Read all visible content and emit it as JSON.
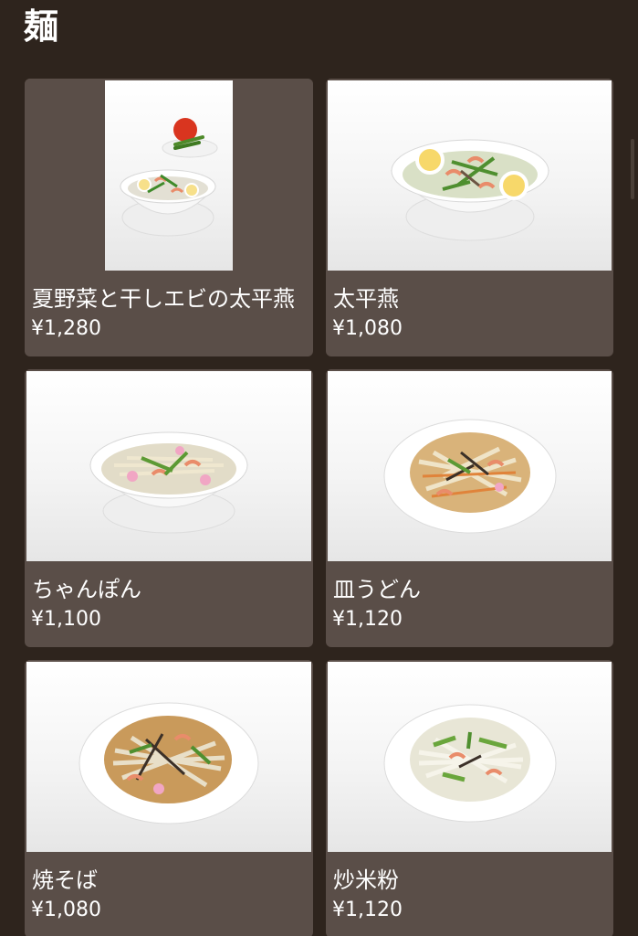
{
  "section": {
    "title": "麺"
  },
  "menu": {
    "items": [
      {
        "name": "夏野菜と干しエビの太平燕",
        "price": "¥1,280",
        "image": "bowl-soup-with-tomato-icon"
      },
      {
        "name": "太平燕",
        "price": "¥1,080",
        "image": "bowl-soup-with-eggs-icon"
      },
      {
        "name": "ちゃんぽん",
        "price": "¥1,100",
        "image": "bowl-champon-icon"
      },
      {
        "name": "皿うどん",
        "price": "¥1,120",
        "image": "plate-sara-udon-icon"
      },
      {
        "name": "焼そば",
        "price": "¥1,080",
        "image": "plate-yakisoba-icon"
      },
      {
        "name": "炒米粉",
        "price": "¥1,120",
        "image": "plate-rice-noodle-icon"
      }
    ]
  },
  "colors": {
    "background": "#2e241d",
    "card": "#5a4e48",
    "text": "#ffffff"
  }
}
